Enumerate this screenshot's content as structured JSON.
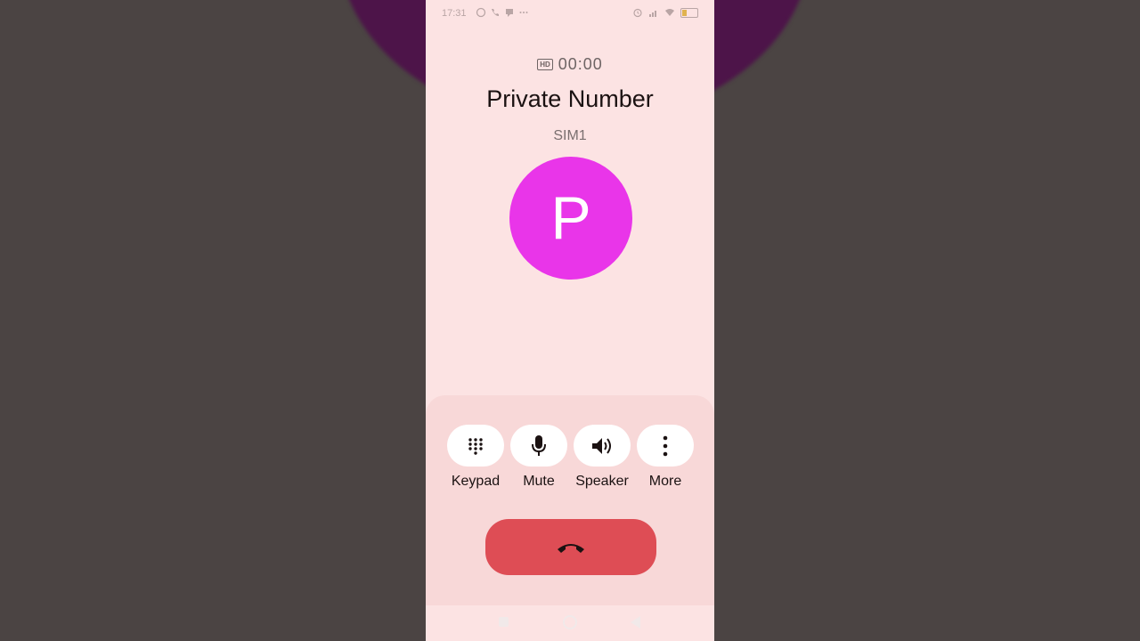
{
  "status_bar": {
    "time": "17:31",
    "left_icons": [
      "whatsapp-icon",
      "phone-icon",
      "message-icon",
      "more-dots-icon"
    ],
    "right_icons": [
      "alarm-icon",
      "signal-icon",
      "wifi-icon",
      "battery-icon"
    ]
  },
  "call": {
    "hd_badge": "HD",
    "timer": "00:00",
    "caller_name": "Private Number",
    "sim": "SIM1",
    "avatar_letter": "P",
    "avatar_color": "#e935e9"
  },
  "controls": [
    {
      "label": "Keypad",
      "icon": "keypad-icon"
    },
    {
      "label": "Mute",
      "icon": "microphone-icon"
    },
    {
      "label": "Speaker",
      "icon": "speaker-icon"
    },
    {
      "label": "More",
      "icon": "more-vertical-icon"
    }
  ],
  "end_call": {
    "icon": "end-call-icon",
    "color": "#de4d55"
  },
  "nav_bar": {
    "icons": [
      "recents-square-icon",
      "home-circle-icon",
      "back-triangle-icon"
    ]
  }
}
